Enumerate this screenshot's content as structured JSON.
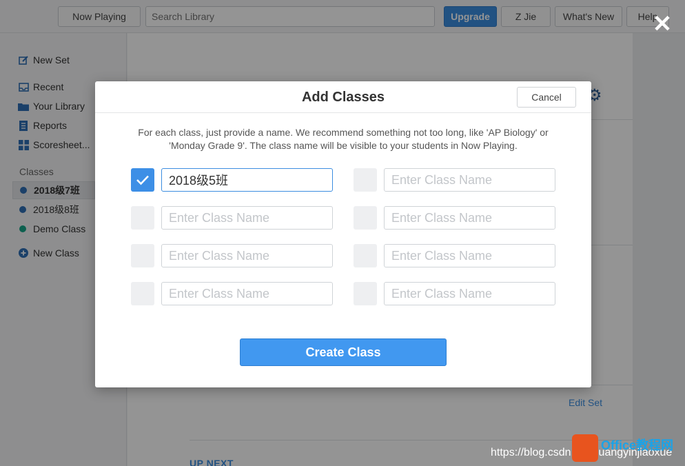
{
  "topbar": {
    "now_playing": "Now Playing",
    "search_placeholder": "Search Library",
    "upgrade": "Upgrade",
    "user": "Z Jie",
    "whats_new": "What's New",
    "help": "Help"
  },
  "sidebar": {
    "new_set": "New Set",
    "recent": "Recent",
    "your_library": "Your Library",
    "reports": "Reports",
    "scoresheets": "Scoresheet...",
    "classes_heading": "Classes",
    "classes": [
      {
        "label": "2018级7班",
        "color": "#2f6fb5"
      },
      {
        "label": "2018级8班",
        "color": "#2f6fb5"
      },
      {
        "label": "Demo Class",
        "color": "#17a589"
      }
    ],
    "new_class": "New Class"
  },
  "main": {
    "edit_set": "Edit Set",
    "up_next": "UP NEXT"
  },
  "modal": {
    "title": "Add Classes",
    "cancel": "Cancel",
    "description": "For each class, just provide a name. We recommend something not too long, like 'AP Biology' or 'Monday Grade 9'. The class name will be visible to your students in Now Playing.",
    "placeholder": "Enter Class Name",
    "fields": [
      {
        "value": "2018级5班",
        "checked": true
      },
      {
        "value": "",
        "checked": false
      },
      {
        "value": "",
        "checked": false
      },
      {
        "value": "",
        "checked": false
      },
      {
        "value": "",
        "checked": false
      },
      {
        "value": "",
        "checked": false
      },
      {
        "value": "",
        "checked": false
      },
      {
        "value": "",
        "checked": false
      }
    ],
    "create": "Create Class"
  },
  "colors": {
    "accent": "#3b8de0",
    "checkbox_on": "#3d8fe6"
  },
  "icons": {
    "close": "close-icon",
    "check": "checkmark-icon",
    "settings": "gear-icon"
  },
  "watermark": {
    "url": "https://blog.csdn.net/huangyinjiaoxue",
    "brand": "Office教程网"
  }
}
